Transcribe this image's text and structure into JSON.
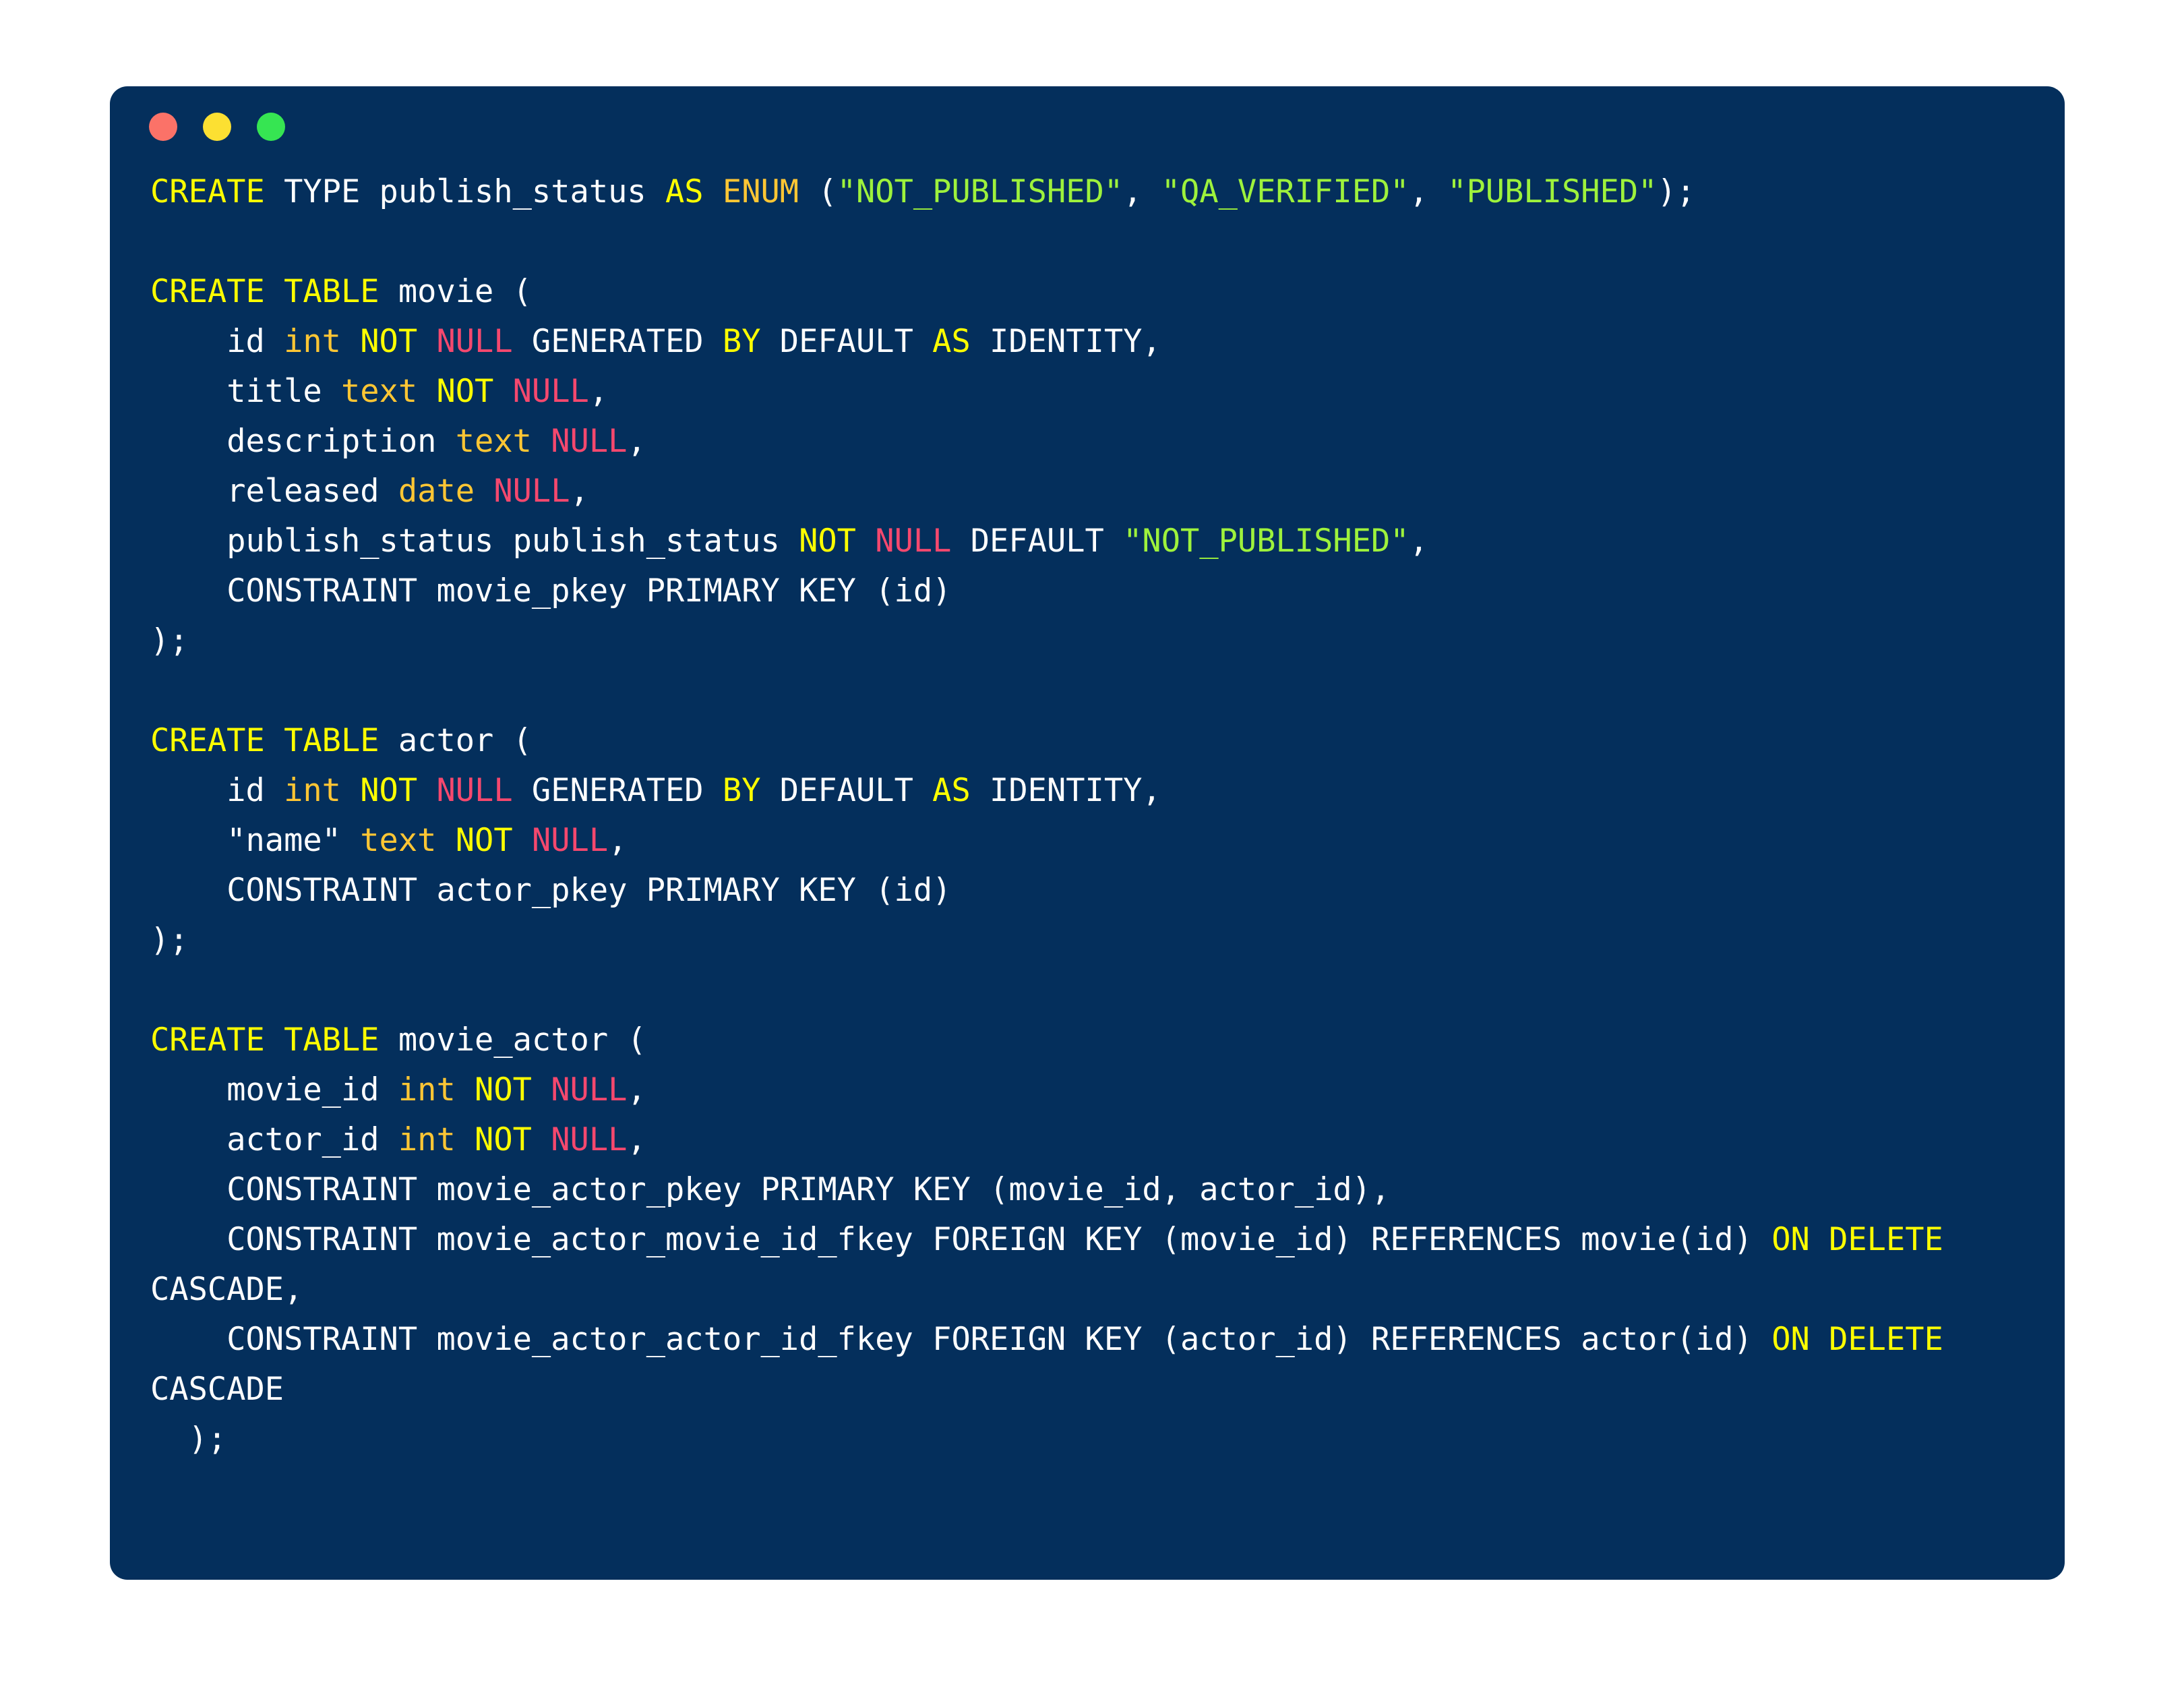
{
  "window": {
    "background_color": "#042F5C",
    "corner_radius_px": 26,
    "traffic_lights": [
      {
        "name": "close",
        "color": "#FB7268",
        "label": "Close"
      },
      {
        "name": "minimize",
        "color": "#FCE032",
        "label": "Minimize"
      },
      {
        "name": "zoom",
        "color": "#36E552",
        "label": "Zoom"
      }
    ]
  },
  "theme": {
    "keyword_color": "#FFFF00",
    "type_color": "#FFC634",
    "null_color": "#F5486E",
    "string_color": "#9EF23C",
    "text_color": "#FFFFFF",
    "background_color": "#042F5C"
  },
  "code": {
    "language": "sql",
    "full_text": "CREATE TYPE publish_status AS ENUM (\"NOT_PUBLISHED\", \"QA_VERIFIED\", \"PUBLISHED\");\n\nCREATE TABLE movie (\n    id int NOT NULL GENERATED BY DEFAULT AS IDENTITY,\n    title text NOT NULL,\n    description text NULL,\n    released date NULL,\n    publish_status publish_status NOT NULL DEFAULT \"NOT_PUBLISHED\",\n    CONSTRAINT movie_pkey PRIMARY KEY (id)\n);\n\nCREATE TABLE actor (\n    id int NOT NULL GENERATED BY DEFAULT AS IDENTITY,\n    \"name\" text NOT NULL,\n    CONSTRAINT actor_pkey PRIMARY KEY (id)\n);\n\nCREATE TABLE movie_actor (\n    movie_id int NOT NULL,\n    actor_id int NOT NULL,\n    CONSTRAINT movie_actor_pkey PRIMARY KEY (movie_id, actor_id),\n    CONSTRAINT movie_actor_movie_id_fkey FOREIGN KEY (movie_id) REFERENCES movie(id) ON DELETE CASCADE,\n    CONSTRAINT movie_actor_actor_id_fkey FOREIGN KEY (actor_id) REFERENCES actor(id) ON DELETE CASCADE\n  );",
    "lines": [
      {
        "n": 1,
        "text": "CREATE TYPE publish_status AS ENUM (\"NOT_PUBLISHED\", \"QA_VERIFIED\", \"PUBLISHED\");"
      },
      {
        "n": 2,
        "text": ""
      },
      {
        "n": 3,
        "text": "CREATE TABLE movie ("
      },
      {
        "n": 4,
        "text": "    id int NOT NULL GENERATED BY DEFAULT AS IDENTITY,"
      },
      {
        "n": 5,
        "text": "    title text NOT NULL,"
      },
      {
        "n": 6,
        "text": "    description text NULL,"
      },
      {
        "n": 7,
        "text": "    released date NULL,"
      },
      {
        "n": 8,
        "text": "    publish_status publish_status NOT NULL DEFAULT \"NOT_PUBLISHED\","
      },
      {
        "n": 9,
        "text": "    CONSTRAINT movie_pkey PRIMARY KEY (id)"
      },
      {
        "n": 10,
        "text": ");"
      },
      {
        "n": 11,
        "text": ""
      },
      {
        "n": 12,
        "text": "CREATE TABLE actor ("
      },
      {
        "n": 13,
        "text": "    id int NOT NULL GENERATED BY DEFAULT AS IDENTITY,"
      },
      {
        "n": 14,
        "text": "    \"name\" text NOT NULL,"
      },
      {
        "n": 15,
        "text": "    CONSTRAINT actor_pkey PRIMARY KEY (id)"
      },
      {
        "n": 16,
        "text": ");"
      },
      {
        "n": 17,
        "text": ""
      },
      {
        "n": 18,
        "text": "CREATE TABLE movie_actor ("
      },
      {
        "n": 19,
        "text": "    movie_id int NOT NULL,"
      },
      {
        "n": 20,
        "text": "    actor_id int NOT NULL,"
      },
      {
        "n": 21,
        "text": "    CONSTRAINT movie_actor_pkey PRIMARY KEY (movie_id, actor_id),"
      },
      {
        "n": 22,
        "text": "    CONSTRAINT movie_actor_movie_id_fkey FOREIGN KEY (movie_id) REFERENCES movie(id) ON DELETE CASCADE,"
      },
      {
        "n": 23,
        "text": "    CONSTRAINT movie_actor_actor_id_fkey FOREIGN KEY (actor_id) REFERENCES actor(id) ON DELETE CASCADE"
      },
      {
        "n": 24,
        "text": "  );"
      }
    ],
    "tokens": [
      {
        "t": "CREATE",
        "c": "kw"
      },
      {
        "t": " "
      },
      {
        "t": "TYPE",
        "c": "plain"
      },
      {
        "t": " publish_status "
      },
      {
        "t": "AS",
        "c": "kw"
      },
      {
        "t": " "
      },
      {
        "t": "ENUM",
        "c": "type"
      },
      {
        "t": " ("
      },
      {
        "t": "\"NOT_PUBLISHED\"",
        "c": "str"
      },
      {
        "t": ", "
      },
      {
        "t": "\"QA_VERIFIED\"",
        "c": "str"
      },
      {
        "t": ", "
      },
      {
        "t": "\"PUBLISHED\"",
        "c": "str"
      },
      {
        "t": ");"
      },
      {
        "t": "\n\n"
      },
      {
        "t": "CREATE",
        "c": "kw"
      },
      {
        "t": " "
      },
      {
        "t": "TABLE",
        "c": "kw"
      },
      {
        "t": " movie (\n    id "
      },
      {
        "t": "int",
        "c": "type"
      },
      {
        "t": " "
      },
      {
        "t": "NOT",
        "c": "kw"
      },
      {
        "t": " "
      },
      {
        "t": "NULL",
        "c": "null"
      },
      {
        "t": " GENERATED "
      },
      {
        "t": "BY",
        "c": "kw"
      },
      {
        "t": " DEFAULT "
      },
      {
        "t": "AS",
        "c": "kw"
      },
      {
        "t": " IDENTITY,\n    title "
      },
      {
        "t": "text",
        "c": "type"
      },
      {
        "t": " "
      },
      {
        "t": "NOT",
        "c": "kw"
      },
      {
        "t": " "
      },
      {
        "t": "NULL",
        "c": "null"
      },
      {
        "t": ",\n    description "
      },
      {
        "t": "text",
        "c": "type"
      },
      {
        "t": " "
      },
      {
        "t": "NULL",
        "c": "null"
      },
      {
        "t": ",\n    released "
      },
      {
        "t": "date",
        "c": "type"
      },
      {
        "t": " "
      },
      {
        "t": "NULL",
        "c": "null"
      },
      {
        "t": ",\n    publish_status publish_status "
      },
      {
        "t": "NOT",
        "c": "kw"
      },
      {
        "t": " "
      },
      {
        "t": "NULL",
        "c": "null"
      },
      {
        "t": " DEFAULT "
      },
      {
        "t": "\"NOT_PUBLISHED\"",
        "c": "str"
      },
      {
        "t": ",\n    CONSTRAINT movie_pkey PRIMARY KEY (id)\n);\n\n"
      },
      {
        "t": "CREATE",
        "c": "kw"
      },
      {
        "t": " "
      },
      {
        "t": "TABLE",
        "c": "kw"
      },
      {
        "t": " actor (\n    id "
      },
      {
        "t": "int",
        "c": "type"
      },
      {
        "t": " "
      },
      {
        "t": "NOT",
        "c": "kw"
      },
      {
        "t": " "
      },
      {
        "t": "NULL",
        "c": "null"
      },
      {
        "t": " GENERATED "
      },
      {
        "t": "BY",
        "c": "kw"
      },
      {
        "t": " DEFAULT "
      },
      {
        "t": "AS",
        "c": "kw"
      },
      {
        "t": " IDENTITY,\n    \"name\" "
      },
      {
        "t": "text",
        "c": "type"
      },
      {
        "t": " "
      },
      {
        "t": "NOT",
        "c": "kw"
      },
      {
        "t": " "
      },
      {
        "t": "NULL",
        "c": "null"
      },
      {
        "t": ",\n    CONSTRAINT actor_pkey PRIMARY KEY (id)\n);\n\n"
      },
      {
        "t": "CREATE",
        "c": "kw"
      },
      {
        "t": " "
      },
      {
        "t": "TABLE",
        "c": "kw"
      },
      {
        "t": " movie_actor (\n    movie_id "
      },
      {
        "t": "int",
        "c": "type"
      },
      {
        "t": " "
      },
      {
        "t": "NOT",
        "c": "kw"
      },
      {
        "t": " "
      },
      {
        "t": "NULL",
        "c": "null"
      },
      {
        "t": ",\n    actor_id "
      },
      {
        "t": "int",
        "c": "type"
      },
      {
        "t": " "
      },
      {
        "t": "NOT",
        "c": "kw"
      },
      {
        "t": " "
      },
      {
        "t": "NULL",
        "c": "null"
      },
      {
        "t": ",\n    CONSTRAINT movie_actor_pkey PRIMARY KEY (movie_id, actor_id),\n    CONSTRAINT movie_actor_movie_id_fkey FOREIGN KEY (movie_id) REFERENCES movie(id) "
      },
      {
        "t": "ON",
        "c": "kw"
      },
      {
        "t": " "
      },
      {
        "t": "DELETE",
        "c": "kw"
      },
      {
        "t": " CASCADE,\n    CONSTRAINT movie_actor_actor_id_fkey FOREIGN KEY (actor_id) REFERENCES actor(id) "
      },
      {
        "t": "ON",
        "c": "kw"
      },
      {
        "t": " "
      },
      {
        "t": "DELETE",
        "c": "kw"
      },
      {
        "t": " CASCADE\n  );"
      }
    ]
  }
}
